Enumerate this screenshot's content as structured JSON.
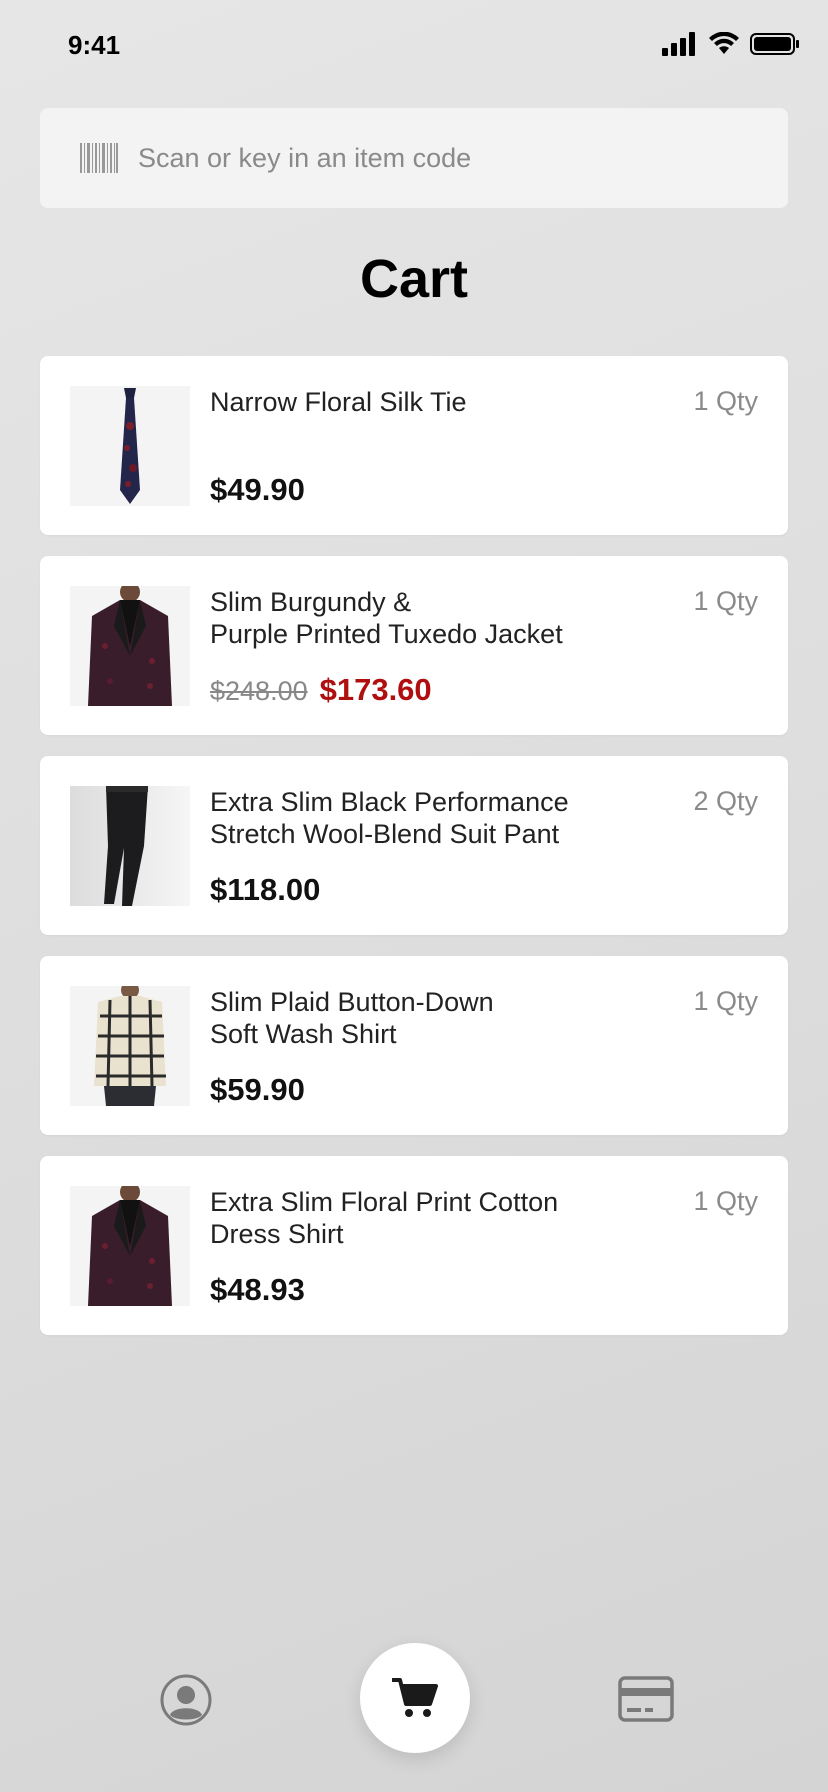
{
  "status": {
    "time": "9:41"
  },
  "search": {
    "placeholder": "Scan or key in an item code"
  },
  "page": {
    "title": "Cart"
  },
  "cart_items": [
    {
      "name": "Narrow Floral Silk Tie",
      "qty": "1 Qty",
      "price": "$49.90",
      "original_price": null,
      "image": "tie"
    },
    {
      "name": "Slim Burgundy &\nPurple Printed Tuxedo Jacket",
      "qty": "1 Qty",
      "price": "$173.60",
      "original_price": "$248.00",
      "image": "tuxedo-jacket"
    },
    {
      "name": "Extra Slim Black Performance\nStretch Wool-Blend Suit Pant",
      "qty": "2 Qty",
      "price": "$118.00",
      "original_price": null,
      "image": "suit-pant"
    },
    {
      "name": "Slim Plaid Button-Down\nSoft Wash Shirt",
      "qty": "1 Qty",
      "price": "$59.90",
      "original_price": null,
      "image": "plaid-shirt"
    },
    {
      "name": "Extra Slim Floral Print Cotton\nDress Shirt",
      "qty": "1 Qty",
      "price": "$48.93",
      "original_price": null,
      "image": "tuxedo-jacket"
    }
  ],
  "colors": {
    "sale": "#b00f0f",
    "muted": "#8a8a8a",
    "background": "#e0e0e0"
  },
  "tab_bar": {
    "items": [
      "profile-icon",
      "cart-icon",
      "credit-card-icon"
    ],
    "active": "cart-icon"
  }
}
